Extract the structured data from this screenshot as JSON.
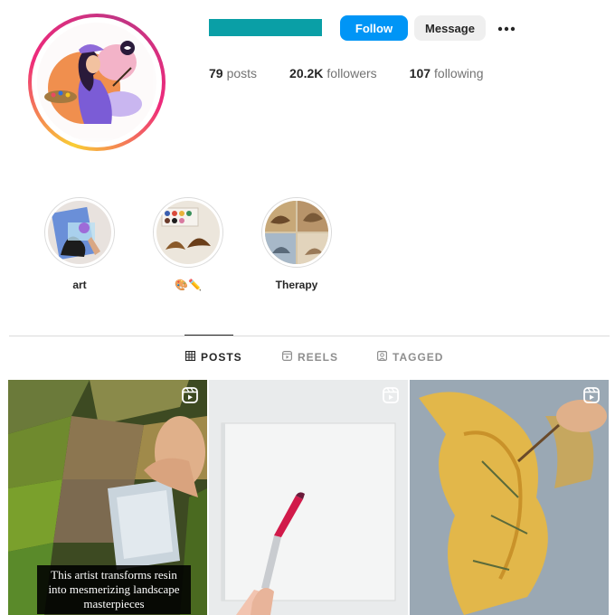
{
  "profile": {
    "username_bar_color": "#0a9fa6"
  },
  "actions": {
    "follow_label": "Follow",
    "message_label": "Message",
    "more_icon": "more-horizontal-icon"
  },
  "stats": [
    {
      "count": "79",
      "label": "posts"
    },
    {
      "count": "20.2K",
      "label": "followers"
    },
    {
      "count": "107",
      "label": "following"
    }
  ],
  "highlights": [
    {
      "label": "art"
    },
    {
      "label": "🎨✏️"
    },
    {
      "label": "Therapy"
    }
  ],
  "tabs": [
    {
      "label": "POSTS",
      "icon": "grid-icon",
      "active": true
    },
    {
      "label": "REELS",
      "icon": "reels-icon",
      "active": false
    },
    {
      "label": "TAGGED",
      "icon": "tagged-icon",
      "active": false
    }
  ],
  "posts": [
    {
      "type": "reel",
      "caption": "This artist transforms resin into mesmerizing landscape masterpieces"
    },
    {
      "type": "reel",
      "caption": ""
    },
    {
      "type": "reel",
      "caption": ""
    }
  ],
  "colors": {
    "accent": "#0095f6",
    "secondary_button": "#efefef"
  }
}
